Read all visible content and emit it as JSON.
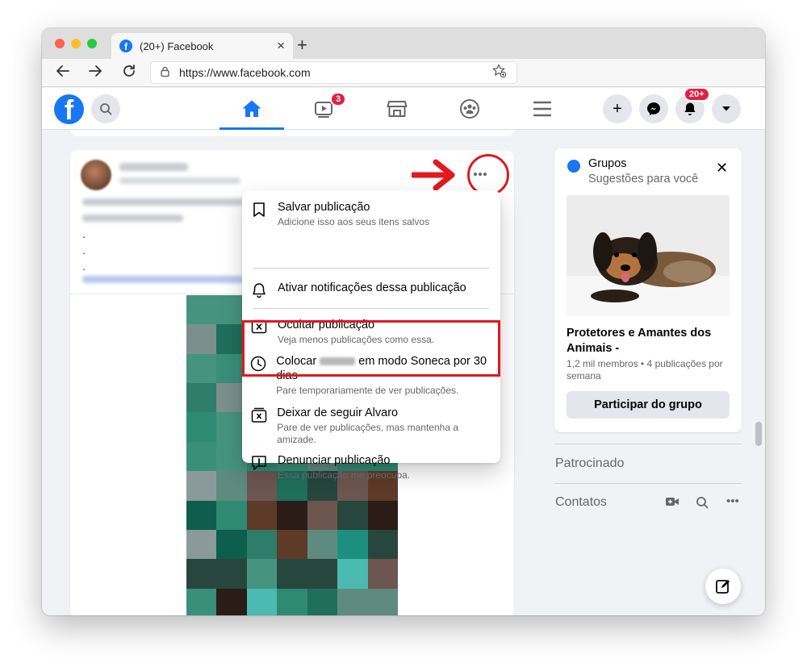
{
  "browser": {
    "tab_title": "(20+) Facebook",
    "tab_favicon_letter": "f",
    "tab_close": "×",
    "new_tab": "+",
    "url": "https://www.facebook.com",
    "icons": [
      "back-arrow-icon",
      "forward-arrow-icon",
      "reload-icon",
      "lock-icon",
      "bookmark-star-icon"
    ]
  },
  "fb_header": {
    "logo_letter": "f",
    "nav": [
      {
        "name": "home",
        "icon": "home-icon",
        "active": true
      },
      {
        "name": "watch",
        "icon": "video-icon",
        "badge": "3"
      },
      {
        "name": "marketplace",
        "icon": "store-icon"
      },
      {
        "name": "groups",
        "icon": "groups-icon"
      },
      {
        "name": "menu",
        "icon": "menu-icon"
      }
    ],
    "actions": {
      "create": "+",
      "notifications_badge": "20+"
    }
  },
  "post": {
    "dots": [
      ".",
      ".",
      "."
    ]
  },
  "menu": {
    "items": [
      {
        "title": "Salvar publicação",
        "subtitle": "Adicione isso aos seus itens salvos",
        "icon": "bookmark-icon"
      },
      {
        "title": "Ativar notificações dessa publicação",
        "subtitle": "",
        "icon": "bell-icon"
      },
      {
        "title": "Ocultar publicação",
        "subtitle": "Veja menos publicações como essa.",
        "icon": "hide-icon"
      },
      {
        "title_before": "Colocar",
        "title_after": "em modo Soneca por 30 dias",
        "subtitle": "Pare temporariamente de ver publicações.",
        "icon": "clock-icon"
      },
      {
        "title": "Deixar de seguir Alvaro",
        "subtitle": "Pare de ver publicações, mas mantenha a amizade.",
        "icon": "unfollow-icon"
      },
      {
        "title": "Denunciar publicação",
        "subtitle": "Essa publicação me preocupa.",
        "icon": "report-icon"
      }
    ]
  },
  "groups_card": {
    "title": "Grupos",
    "subtitle": "Sugestões para você",
    "close": "✕",
    "group_name": "Protetores e Amantes dos Animais -",
    "meta": "1,2 mil membros • 4 publicações por semana",
    "join_label": "Participar do grupo"
  },
  "sidebar": {
    "sponsored": "Patrocinado",
    "contacts": "Contatos",
    "contacts_more": "•••"
  },
  "colors": {
    "fb_blue": "#1877f2",
    "annotation_red": "#e4181e",
    "badge_red": "#e41e3f",
    "page_bg": "#f0f2f5"
  }
}
